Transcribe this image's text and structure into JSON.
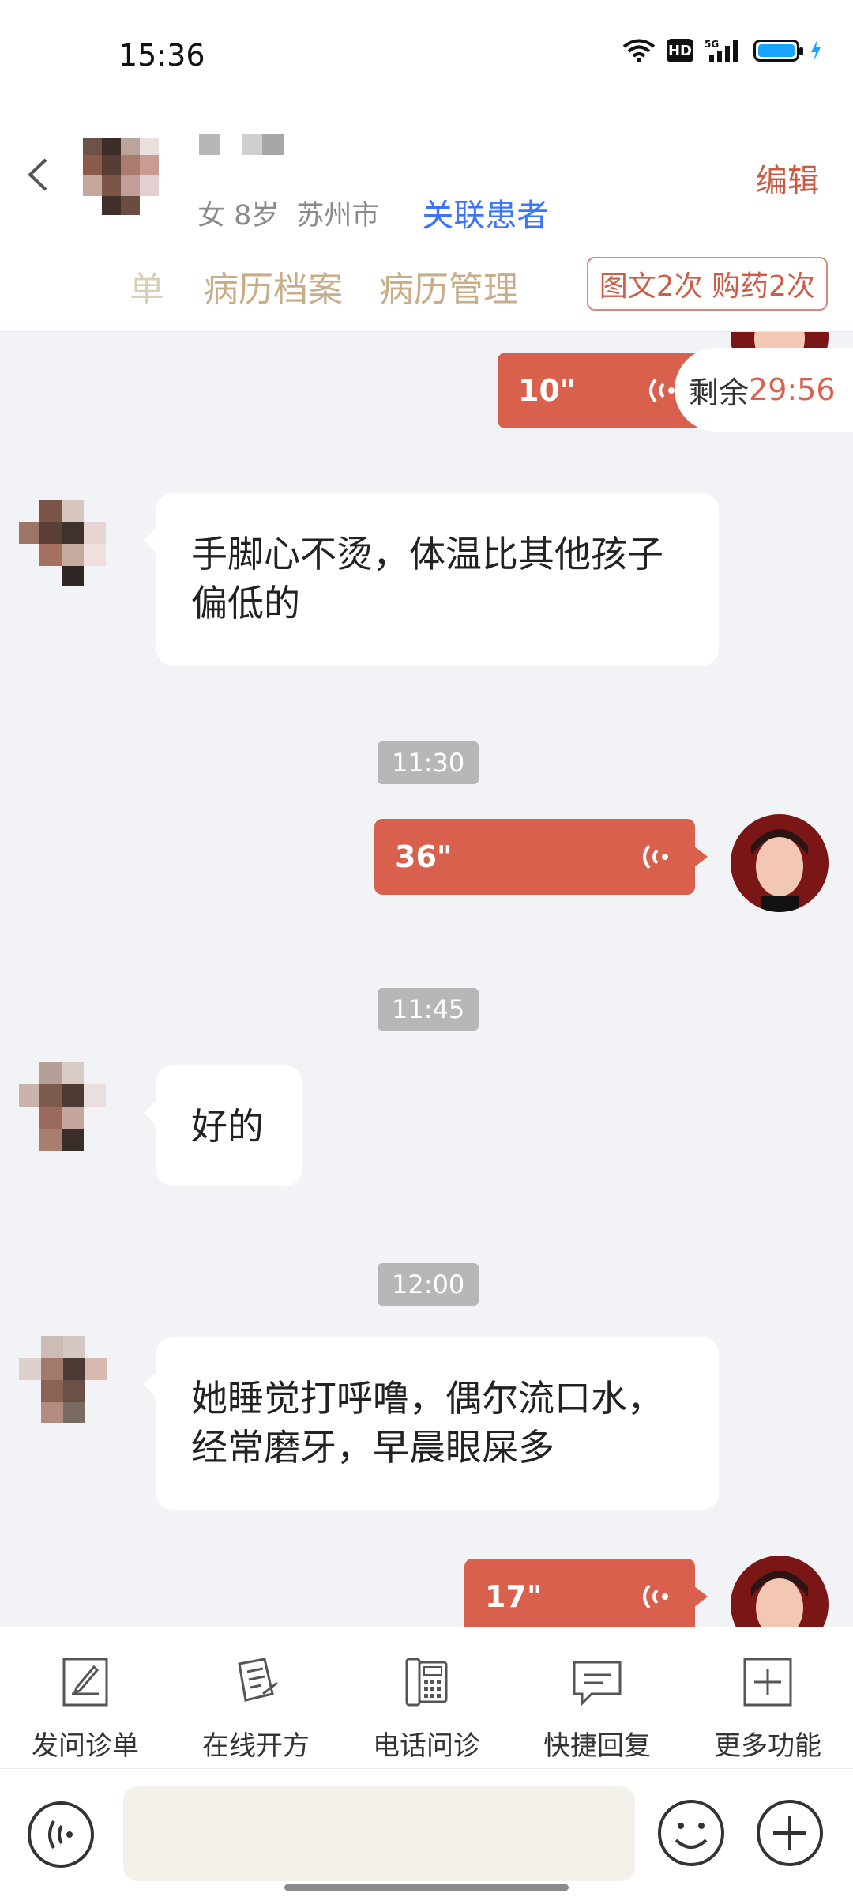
{
  "status_bar": {
    "time": "15:36",
    "hd": "HD",
    "network": "5G"
  },
  "header": {
    "gender_age": "女 8岁",
    "city": "苏州市",
    "link_patient": "关联患者",
    "edit": "编辑"
  },
  "tabs": [
    {
      "label": "单"
    },
    {
      "label": "病历档案"
    },
    {
      "label": "病历管理"
    }
  ],
  "counts_label": "图文2次 购药2次",
  "timer": {
    "prefix": "剩余",
    "value": "29:56"
  },
  "messages": [
    {
      "type": "voice-out",
      "duration": "10\""
    },
    {
      "type": "text-in",
      "text": "手脚心不烫，体温比其他孩子偏低的"
    },
    {
      "type": "timestamp",
      "text": "11:30"
    },
    {
      "type": "voice-out",
      "duration": "36\""
    },
    {
      "type": "timestamp",
      "text": "11:45"
    },
    {
      "type": "text-in",
      "text": "好的"
    },
    {
      "type": "timestamp",
      "text": "12:00"
    },
    {
      "type": "text-in",
      "text": "她睡觉打呼噜，偶尔流口水，经常磨牙，早晨眼屎多"
    },
    {
      "type": "voice-out",
      "duration": "17\""
    }
  ],
  "toolbar": [
    {
      "label": "发问诊单",
      "icon": "form-icon"
    },
    {
      "label": "在线开方",
      "icon": "prescription-icon"
    },
    {
      "label": "电话问诊",
      "icon": "phone-icon"
    },
    {
      "label": "快捷回复",
      "icon": "quick-reply-icon"
    },
    {
      "label": "更多功能",
      "icon": "more-icon"
    }
  ],
  "colors": {
    "accent": "#d9604c",
    "link": "#3d74ff",
    "tab": "#c7ae89"
  }
}
